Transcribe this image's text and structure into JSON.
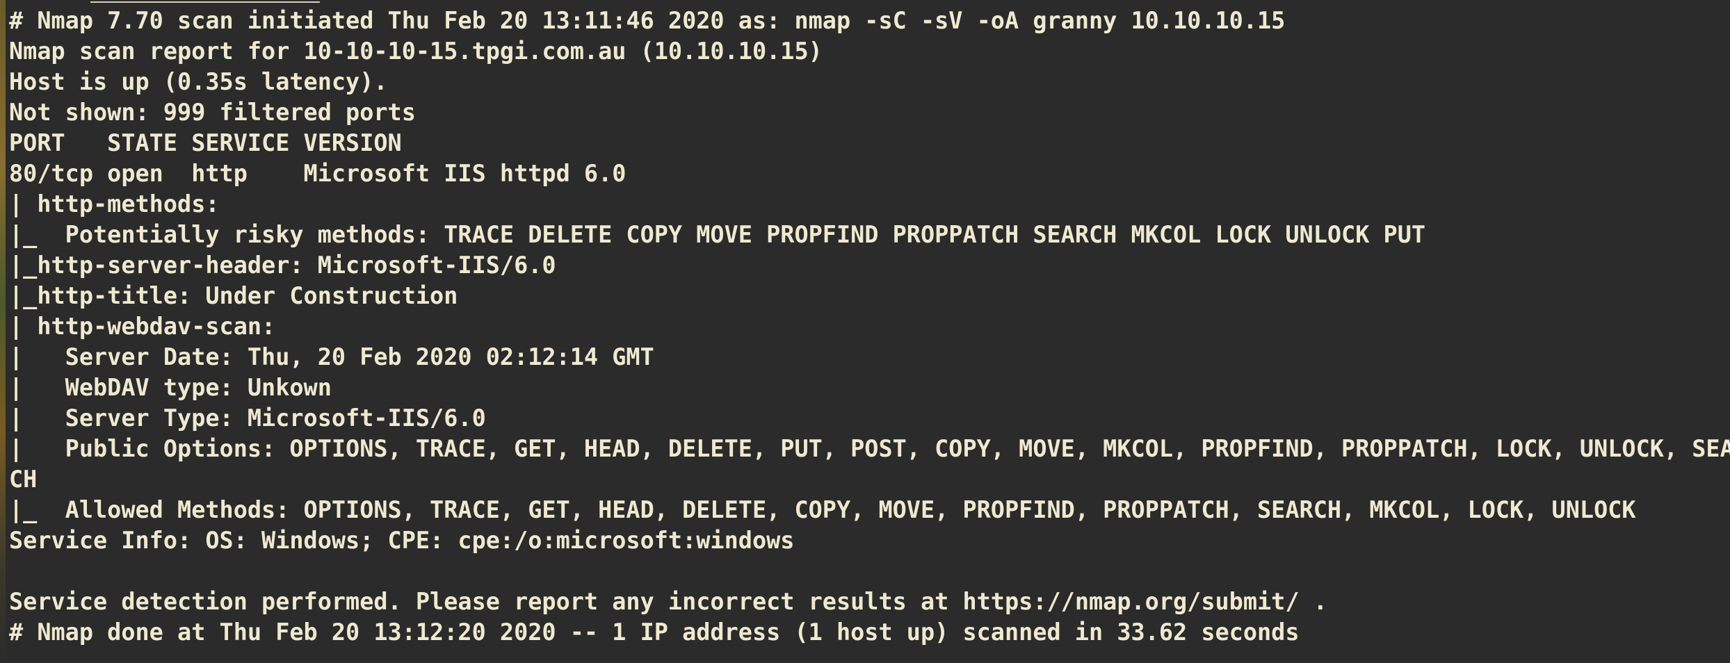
{
  "terminal": {
    "lines": [
      "# Nmap 7.70 scan initiated Thu Feb 20 13:11:46 2020 as: nmap -sC -sV -oA granny 10.10.10.15",
      "Nmap scan report for 10-10-10-15.tpgi.com.au (10.10.10.15)",
      "Host is up (0.35s latency).",
      "Not shown: 999 filtered ports",
      "PORT   STATE SERVICE VERSION",
      "80/tcp open  http    Microsoft IIS httpd 6.0",
      "| http-methods:",
      "|_  Potentially risky methods: TRACE DELETE COPY MOVE PROPFIND PROPPATCH SEARCH MKCOL LOCK UNLOCK PUT",
      "|_http-server-header: Microsoft-IIS/6.0",
      "|_http-title: Under Construction",
      "| http-webdav-scan:",
      "|   Server Date: Thu, 20 Feb 2020 02:12:14 GMT",
      "|   WebDAV type: Unkown",
      "|   Server Type: Microsoft-IIS/6.0",
      "|   Public Options: OPTIONS, TRACE, GET, HEAD, DELETE, PUT, POST, COPY, MOVE, MKCOL, PROPFIND, PROPPATCH, LOCK, UNLOCK, SEAR",
      "CH",
      "|_  Allowed Methods: OPTIONS, TRACE, GET, HEAD, DELETE, COPY, MOVE, PROPFIND, PROPPATCH, SEARCH, MKCOL, LOCK, UNLOCK",
      "Service Info: OS: Windows; CPE: cpe:/o:microsoft:windows",
      "",
      "Service detection performed. Please report any incorrect results at https://nmap.org/submit/ .",
      "# Nmap done at Thu Feb 20 13:12:20 2020 -- 1 IP address (1 host up) scanned in 33.62 seconds"
    ]
  },
  "colors": {
    "background": "#2b2b2b",
    "text": "#eee9d0"
  }
}
